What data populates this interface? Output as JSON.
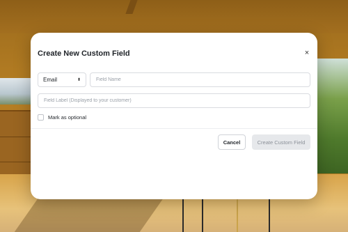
{
  "dialog": {
    "title": "Create New Custom Field",
    "close_glyph": "×",
    "type_select": {
      "value": "Email",
      "arrows_glyph": "⬍"
    },
    "field_name": {
      "placeholder": "Field Name",
      "value": ""
    },
    "field_label": {
      "placeholder": "Field Label (Displayed to your customer)",
      "value": ""
    },
    "optional_checkbox": {
      "label": "Mark as optional",
      "checked": false
    },
    "buttons": {
      "cancel": "Cancel",
      "create": "Create Custom Field"
    }
  },
  "icons": {
    "close": "close-icon",
    "select_arrows": "chevron-up-down-icon"
  },
  "colors": {
    "create_disabled_bg": "#e6e8eb",
    "create_disabled_text": "#8c9199"
  }
}
